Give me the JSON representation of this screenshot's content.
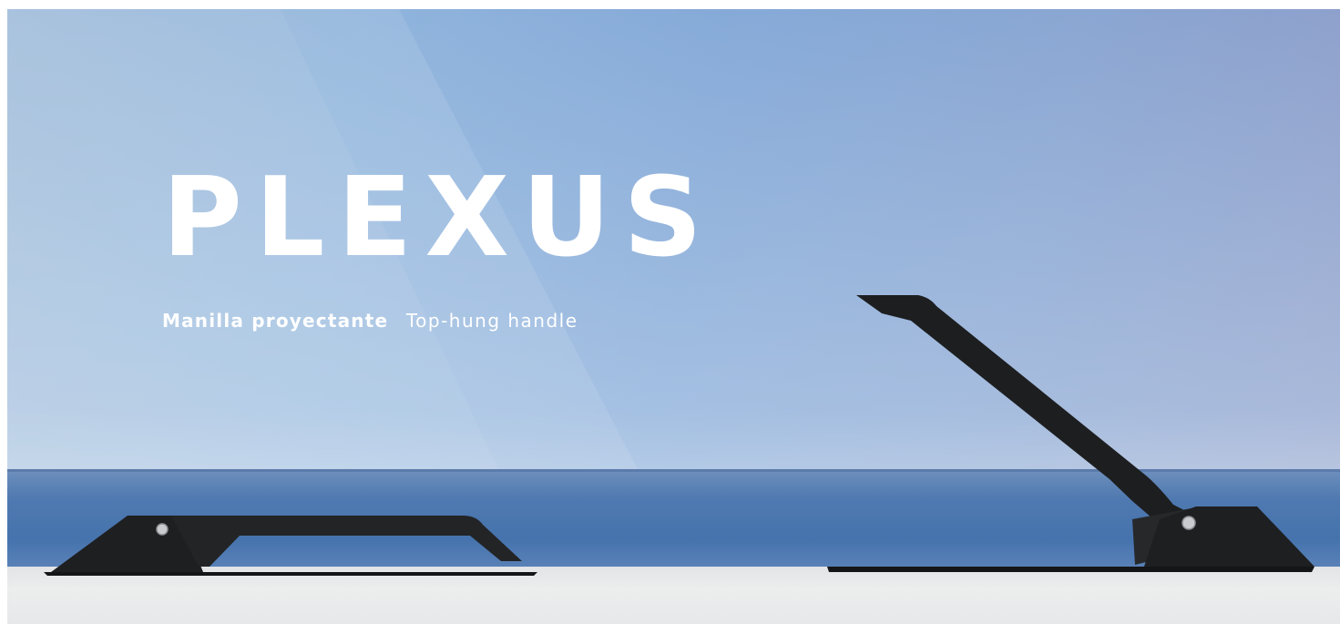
{
  "hero": {
    "title": "PLEXUS",
    "subtitle_es": "Manilla proyectante",
    "subtitle_en": "Top-hung handle"
  },
  "colors": {
    "sky": "#8fb0d8",
    "sea": "#4673ad",
    "ledge": "#e7e8ea",
    "handle": "#1e1f21",
    "text": "#ffffff"
  }
}
